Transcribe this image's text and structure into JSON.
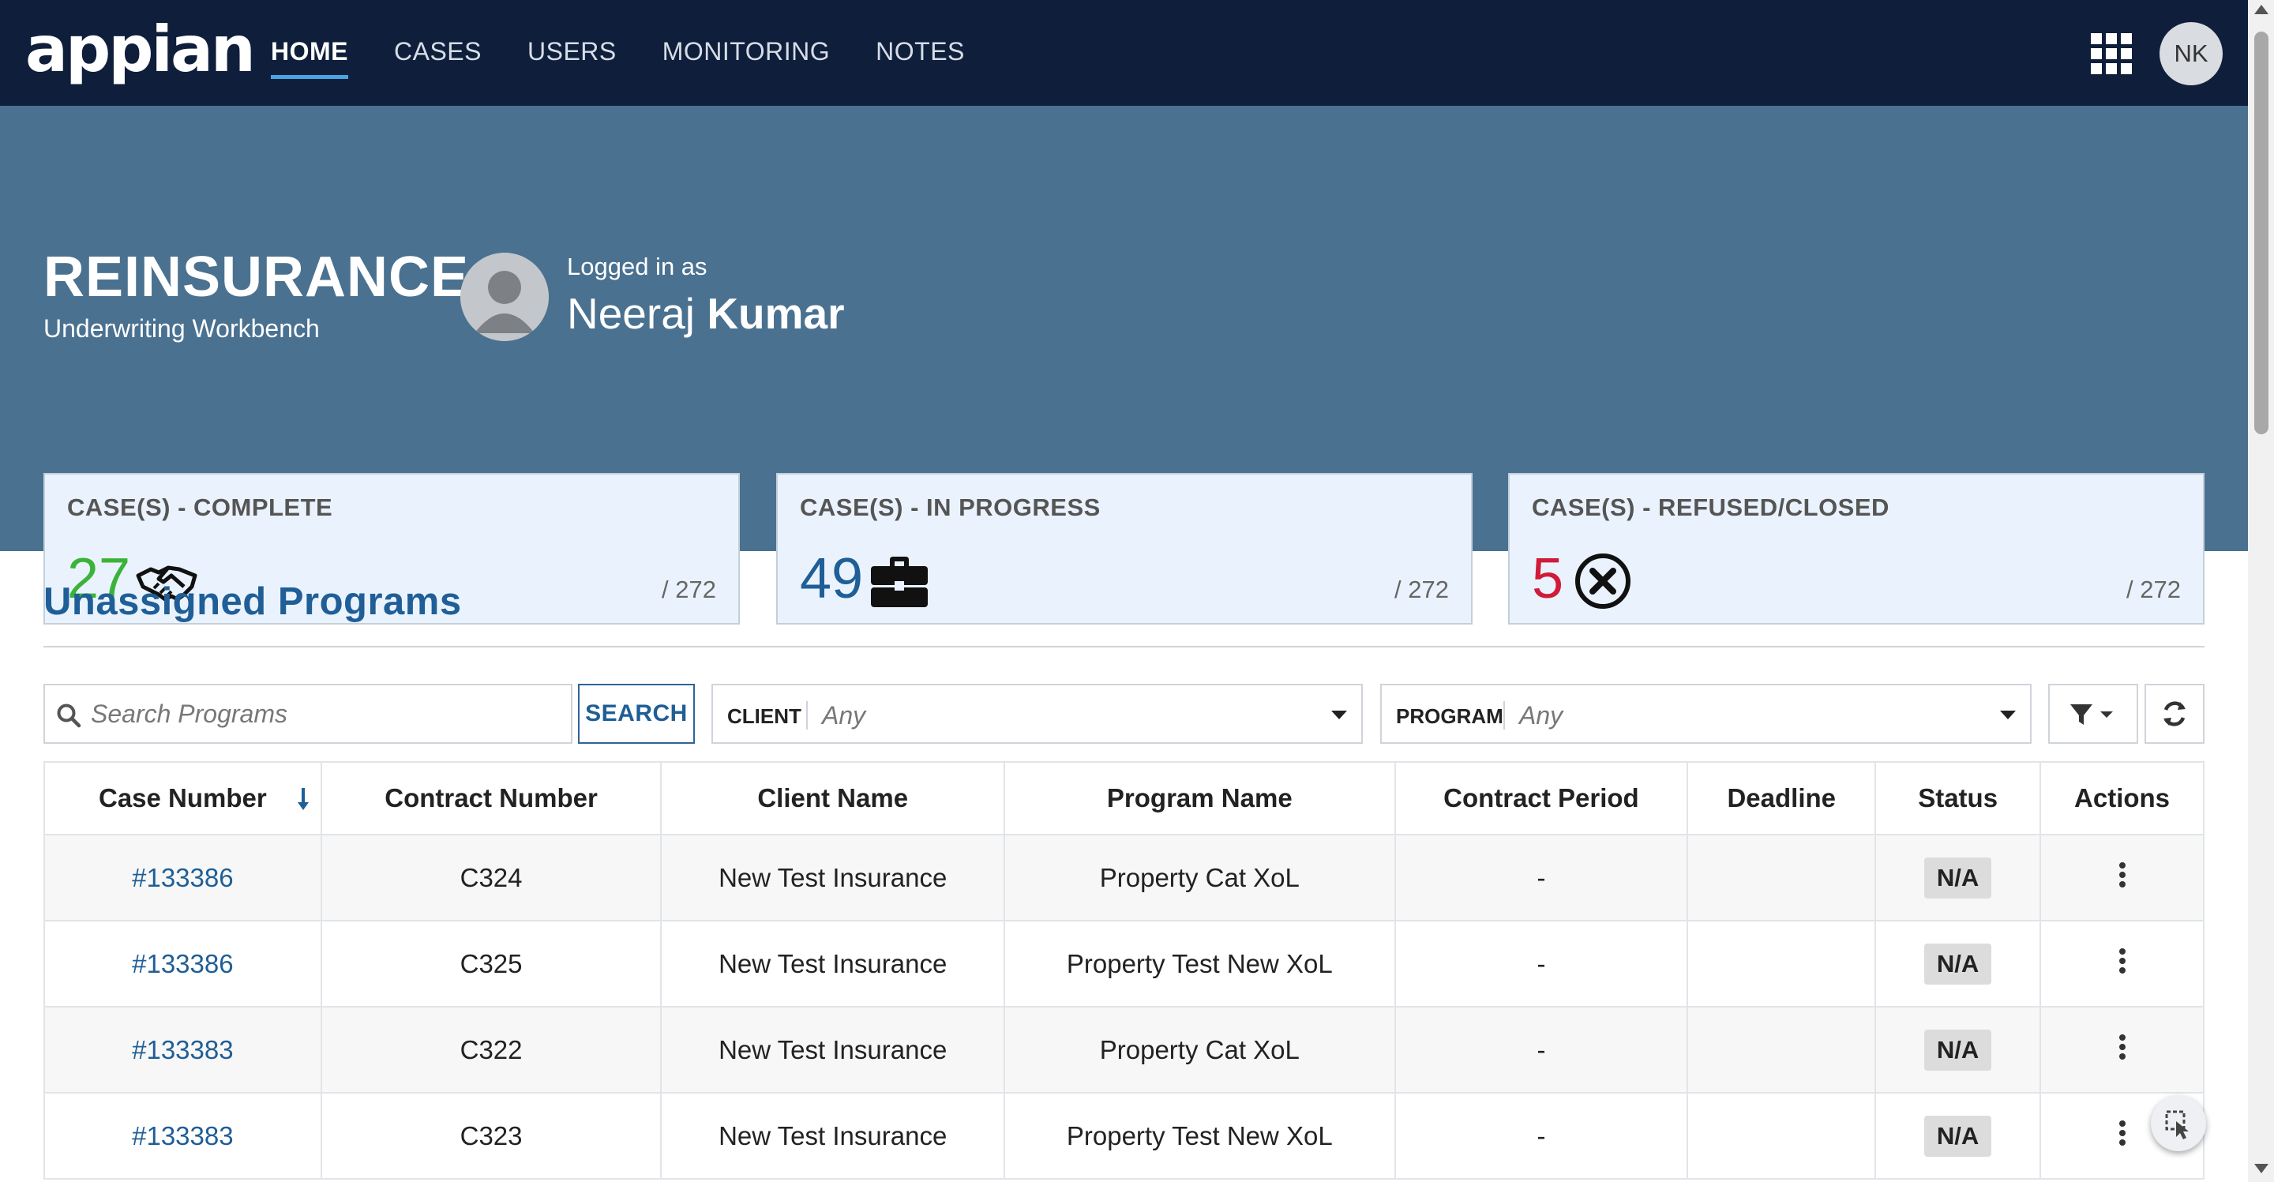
{
  "app": {
    "logo_text": "appian",
    "nav": [
      {
        "label": "HOME",
        "active": true
      },
      {
        "label": "CASES",
        "active": false
      },
      {
        "label": "USERS",
        "active": false
      },
      {
        "label": "MONITORING",
        "active": false
      },
      {
        "label": "NOTES",
        "active": false
      }
    ],
    "apps_icon": "grid-apps-icon",
    "user_initials": "NK"
  },
  "hero": {
    "title": "REINSURANCE",
    "subtitle": "Underwriting Workbench",
    "logged_in_label": "Logged in as",
    "first_name": "Neeraj",
    "last_name": "Kumar",
    "background_color": "#4a7190"
  },
  "stats": [
    {
      "label": "CASE(S) - COMPLETE",
      "count": "27",
      "total": "/ 272",
      "color": "#3bb33b",
      "icon": "handshake-icon"
    },
    {
      "label": "CASE(S) - IN PROGRESS",
      "count": "49",
      "total": "/ 272",
      "color": "#1f5e96",
      "icon": "briefcase-icon"
    },
    {
      "label": "CASE(S) - REFUSED/CLOSED",
      "count": "5",
      "total": "/ 272",
      "color": "#d01b3a",
      "icon": "circle-x-icon"
    }
  ],
  "programs": {
    "title": "Unassigned Programs",
    "search_placeholder": "Search Programs",
    "search_button": "SEARCH",
    "client_filter": {
      "label": "CLIENT",
      "value": "Any"
    },
    "program_filter": {
      "label": "PROGRAM",
      "value": "Any"
    },
    "columns": [
      "Case Number",
      "Contract Number",
      "Client Name",
      "Program Name",
      "Contract Period",
      "Deadline",
      "Status",
      "Actions"
    ],
    "rows": [
      {
        "case": "#133386",
        "contract": "C324",
        "client": "New Test Insurance",
        "program": "Property Cat XoL",
        "period": "-",
        "deadline": "",
        "status": "N/A"
      },
      {
        "case": "#133386",
        "contract": "C325",
        "client": "New Test Insurance",
        "program": "Property Test New XoL",
        "period": "-",
        "deadline": "",
        "status": "N/A"
      },
      {
        "case": "#133383",
        "contract": "C322",
        "client": "New Test Insurance",
        "program": "Property Cat XoL",
        "period": "-",
        "deadline": "",
        "status": "N/A"
      },
      {
        "case": "#133383",
        "contract": "C323",
        "client": "New Test Insurance",
        "program": "Property Test New XoL",
        "period": "-",
        "deadline": "",
        "status": "N/A"
      }
    ]
  }
}
